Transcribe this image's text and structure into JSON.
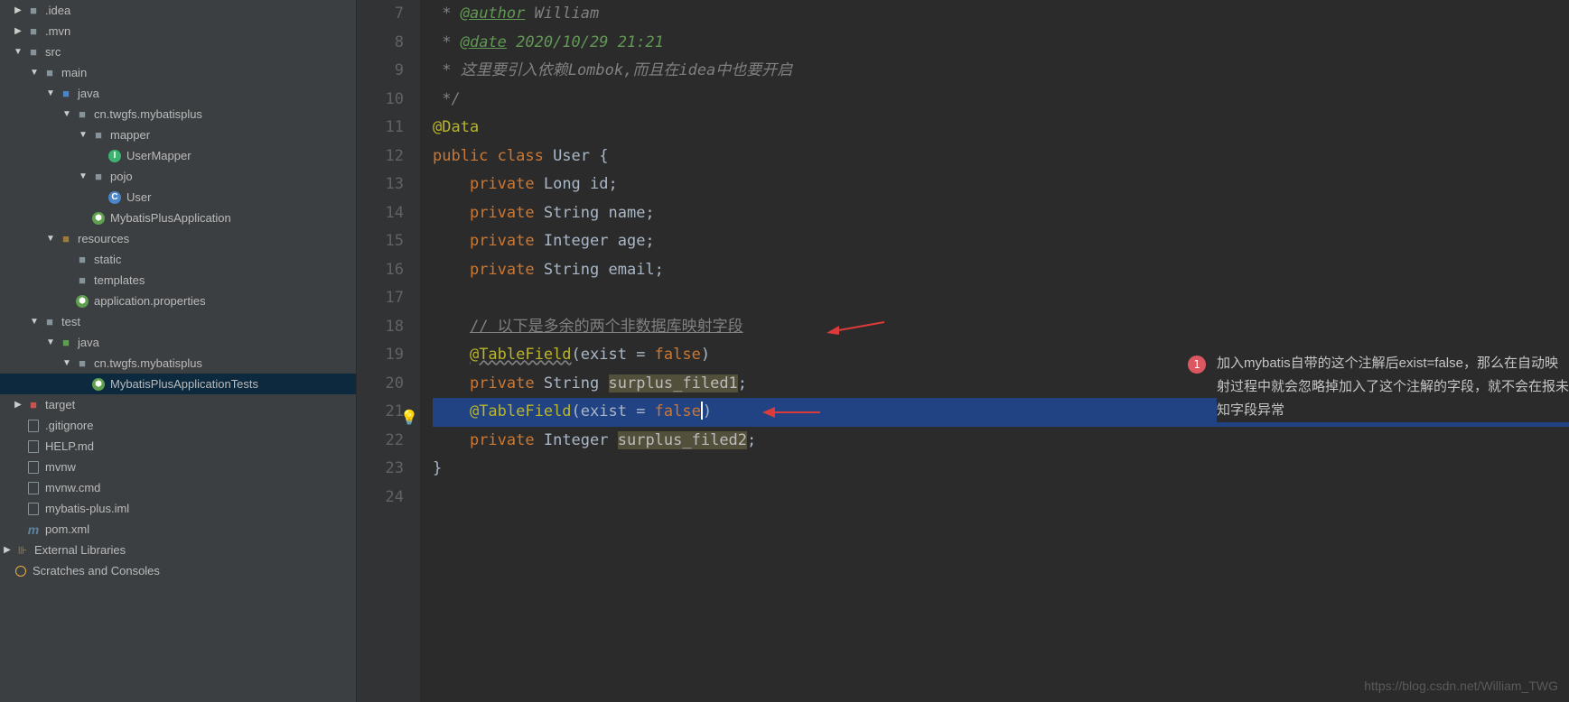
{
  "tree": {
    "idea": ".idea",
    "mvn": ".mvn",
    "src": "src",
    "main": "main",
    "java": "java",
    "pkg": "cn.twgfs.mybatisplus",
    "mapper": "mapper",
    "userMapper": "UserMapper",
    "pojo": "pojo",
    "user": "User",
    "app": "MybatisPlusApplication",
    "resources": "resources",
    "static": "static",
    "templates": "templates",
    "props": "application.properties",
    "test": "test",
    "java2": "java",
    "pkg2": "cn.twgfs.mybatisplus",
    "tests": "MybatisPlusApplicationTests",
    "target": "target",
    "gitignore": ".gitignore",
    "help": "HELP.md",
    "mvnw": "mvnw",
    "mvnwcmd": "mvnw.cmd",
    "iml": "mybatis-plus.iml",
    "pom": "pom.xml",
    "extlib": "External Libraries",
    "scratch": "Scratches and Consoles"
  },
  "gutter": [
    "7",
    "8",
    "9",
    "10",
    "11",
    "12",
    "13",
    "14",
    "15",
    "16",
    "17",
    "18",
    "19",
    "20",
    "21",
    "22",
    "23",
    "24"
  ],
  "code": {
    "l7_a": " * ",
    "l7_b": "@author",
    "l7_c": " William",
    "l8_a": " * ",
    "l8_b": "@date",
    "l8_c": " 2020/10/29 21:21",
    "l9": " * 这里要引入依赖Lombok,而且在idea中也要开启",
    "l10": " */",
    "l11": "@Data",
    "l12_a": "public class ",
    "l12_b": "User {",
    "l13_a": "private ",
    "l13_b": "Long id;",
    "l14_a": "private ",
    "l14_b": "String name;",
    "l15_a": "private ",
    "l15_b": "Integer age;",
    "l16_a": "private ",
    "l16_b": "String email;",
    "l18": "// 以下是多余的两个非数据库映射字段",
    "l19_a": "@TableField",
    "l19_b": "(exist = ",
    "l19_c": "false",
    "l19_d": ")",
    "l20_a": "private ",
    "l20_b": "String ",
    "l20_c": "surplus_filed1",
    "l20_d": ";",
    "l21_a": "@TableField",
    "l21_b": "(exist = ",
    "l21_c": "false",
    "l21_d": ")",
    "l22_a": "private ",
    "l22_b": "Integer ",
    "l22_c": "surplus_filed2",
    "l22_d": ";",
    "l23": "}"
  },
  "callout": {
    "badge": "1",
    "text": "加入mybatis自带的这个注解后exist=false，那么在自动映射过程中就会忽略掉加入了这个注解的字段，就不会在报未知字段异常"
  },
  "watermark": "https://blog.csdn.net/William_TWG"
}
